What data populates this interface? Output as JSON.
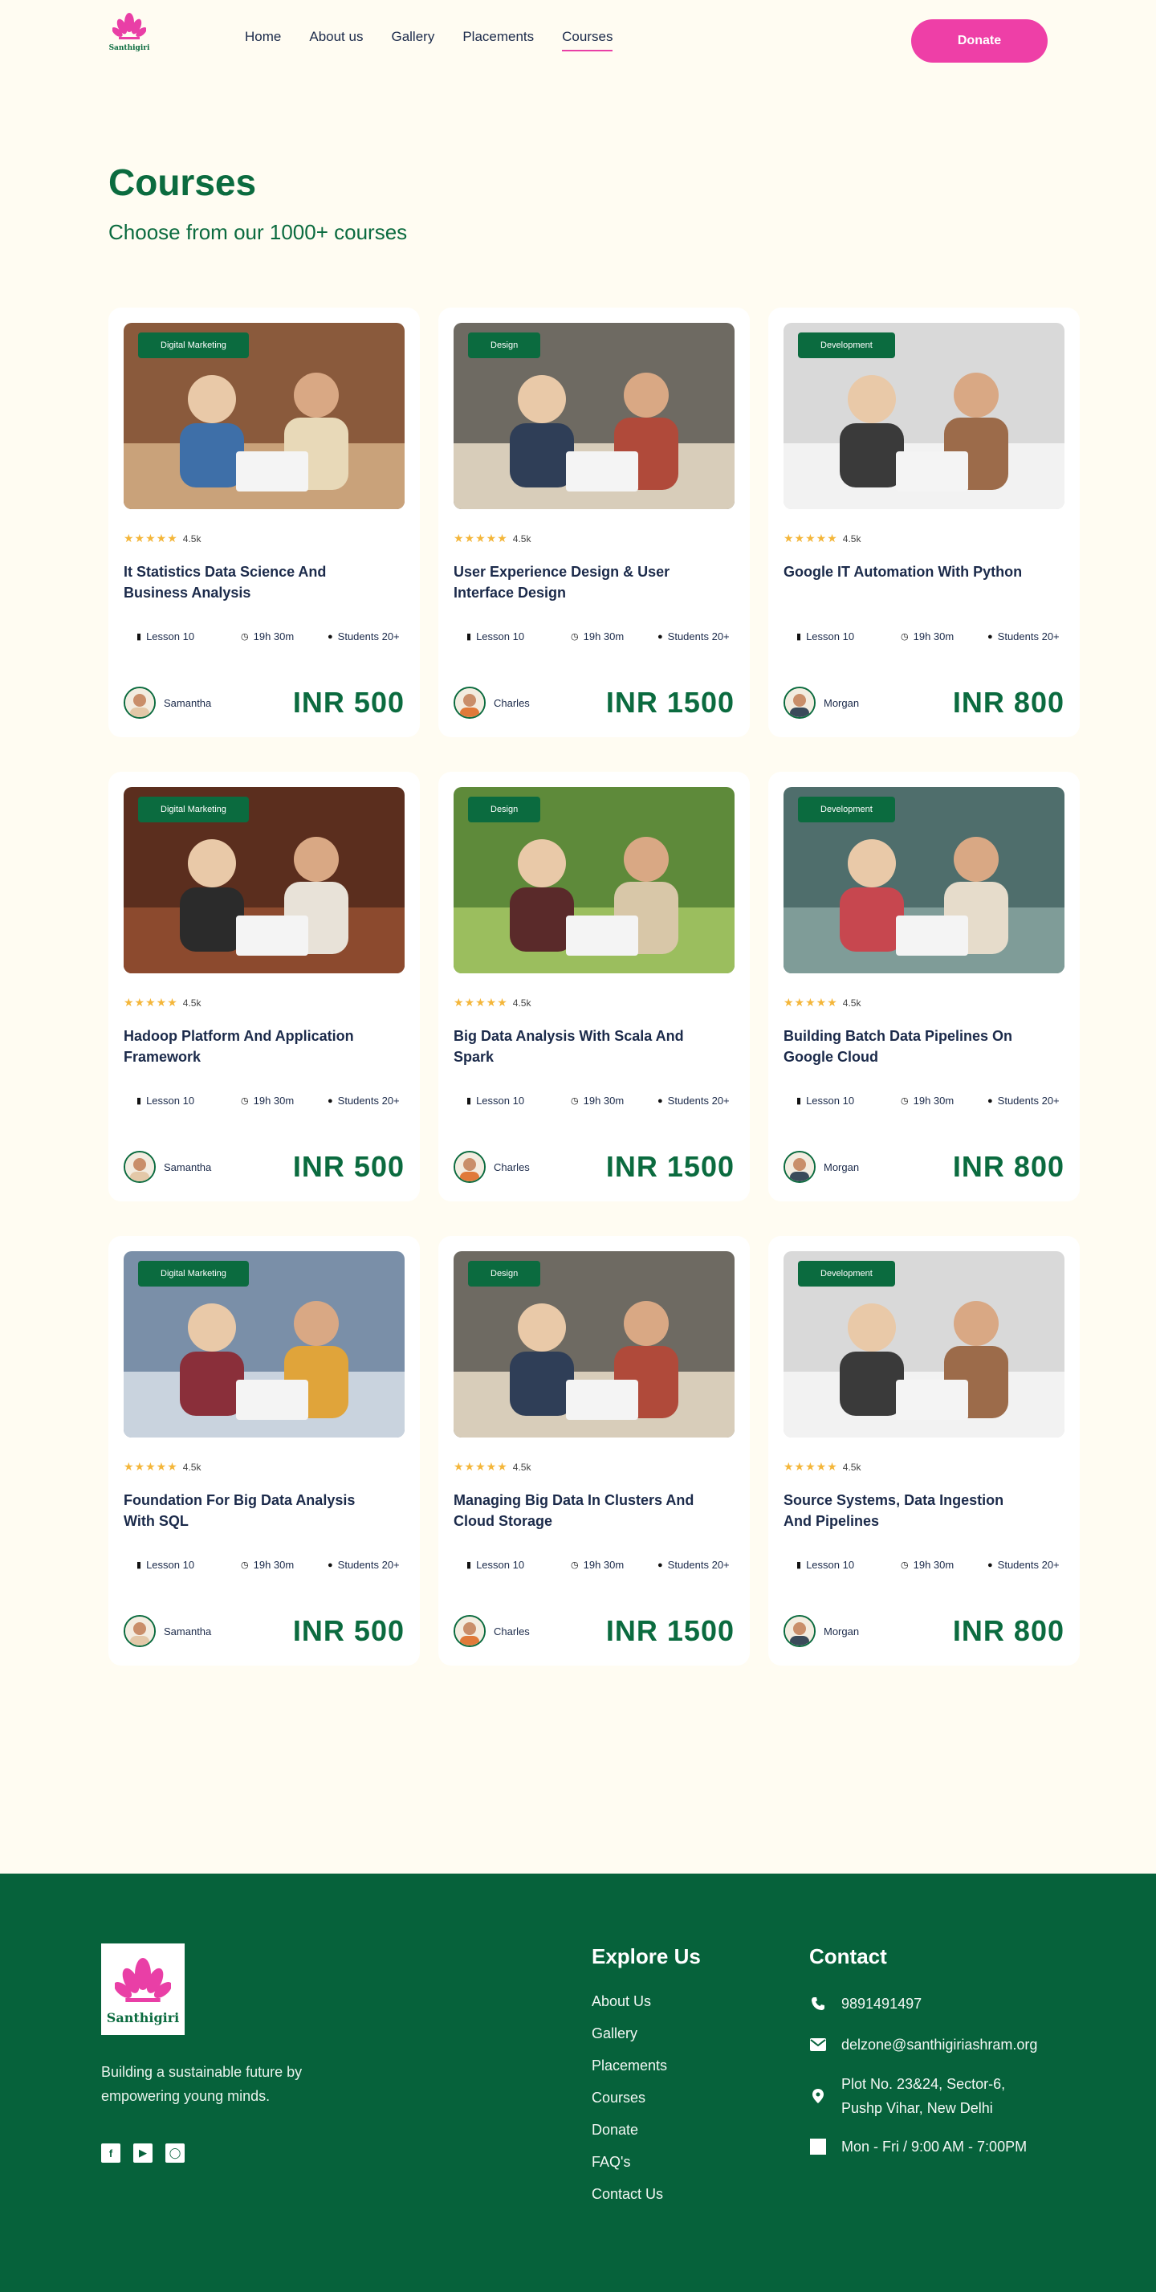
{
  "brand": {
    "logo_text": "Santhigiri",
    "accent": "#EE3FA7",
    "primary": "#0B6B3F"
  },
  "nav": {
    "items": [
      {
        "label": "Home"
      },
      {
        "label": "About us"
      },
      {
        "label": "Gallery"
      },
      {
        "label": "Placements"
      },
      {
        "label": "Courses",
        "active": true
      }
    ],
    "donate_label": "Donate"
  },
  "page": {
    "title": "Courses",
    "subtitle": "Choose from our 1000+ courses"
  },
  "courses": [
    {
      "category": "Digital Marketing",
      "rating": "4.5k",
      "title": "It Statistics Data Science And Business Analysis",
      "lessons": "Lesson 10",
      "duration": "19h 30m",
      "students": "Students 20+",
      "author": "Samantha",
      "price": "INR 500"
    },
    {
      "category": "Design",
      "rating": "4.5k",
      "title": "User Experience Design & User Interface Design",
      "lessons": "Lesson 10",
      "duration": "19h 30m",
      "students": "Students 20+",
      "author": "Charles",
      "price": "INR 1500"
    },
    {
      "category": "Development",
      "rating": "4.5k",
      "title": "Google IT Automation With Python",
      "lessons": "Lesson 10",
      "duration": "19h 30m",
      "students": "Students 20+",
      "author": "Morgan",
      "price": "INR 800"
    },
    {
      "category": "Digital Marketing",
      "rating": "4.5k",
      "title": "Hadoop Platform And Application Framework",
      "lessons": "Lesson 10",
      "duration": "19h 30m",
      "students": "Students 20+",
      "author": "Samantha",
      "price": "INR 500"
    },
    {
      "category": "Design",
      "rating": "4.5k",
      "title": "Big Data Analysis With Scala And Spark",
      "lessons": "Lesson 10",
      "duration": "19h 30m",
      "students": "Students 20+",
      "author": "Charles",
      "price": "INR 1500"
    },
    {
      "category": "Development",
      "rating": "4.5k",
      "title": "Building Batch Data Pipelines On Google Cloud",
      "lessons": "Lesson 10",
      "duration": "19h 30m",
      "students": "Students 20+",
      "author": "Morgan",
      "price": "INR 800"
    },
    {
      "category": "Digital Marketing",
      "rating": "4.5k",
      "title": "Foundation For Big Data Analysis With SQL",
      "lessons": "Lesson 10",
      "duration": "19h 30m",
      "students": "Students 20+",
      "author": "Samantha",
      "price": "INR 500"
    },
    {
      "category": "Design",
      "rating": "4.5k",
      "title": "Managing Big Data In Clusters And Cloud Storage",
      "lessons": "Lesson 10",
      "duration": "19h 30m",
      "students": "Students 20+",
      "author": "Charles",
      "price": "INR 1500"
    },
    {
      "category": "Development",
      "rating": "4.5k",
      "title": "Source Systems, Data Ingestion And Pipelines",
      "lessons": "Lesson 10",
      "duration": "19h 30m",
      "students": "Students 20+",
      "author": "Morgan",
      "price": "INR 800"
    }
  ],
  "footer": {
    "logo_text": "Santhigiri",
    "tagline": "Building a sustainable future by empowering young minds.",
    "explore_heading": "Explore Us",
    "explore_links": [
      "About Us",
      "Gallery",
      "Placements",
      "Courses",
      "Donate",
      "FAQ's",
      "Contact Us"
    ],
    "contact_heading": "Contact",
    "phone": "9891491497",
    "email": "delzone@santhigiriashram.org",
    "address_line1": "Plot No. 23&24, Sector-6,",
    "address_line2": "Pushp Vihar, New Delhi",
    "hours": "Mon - Fri / 9:00 AM - 7:00PM"
  }
}
